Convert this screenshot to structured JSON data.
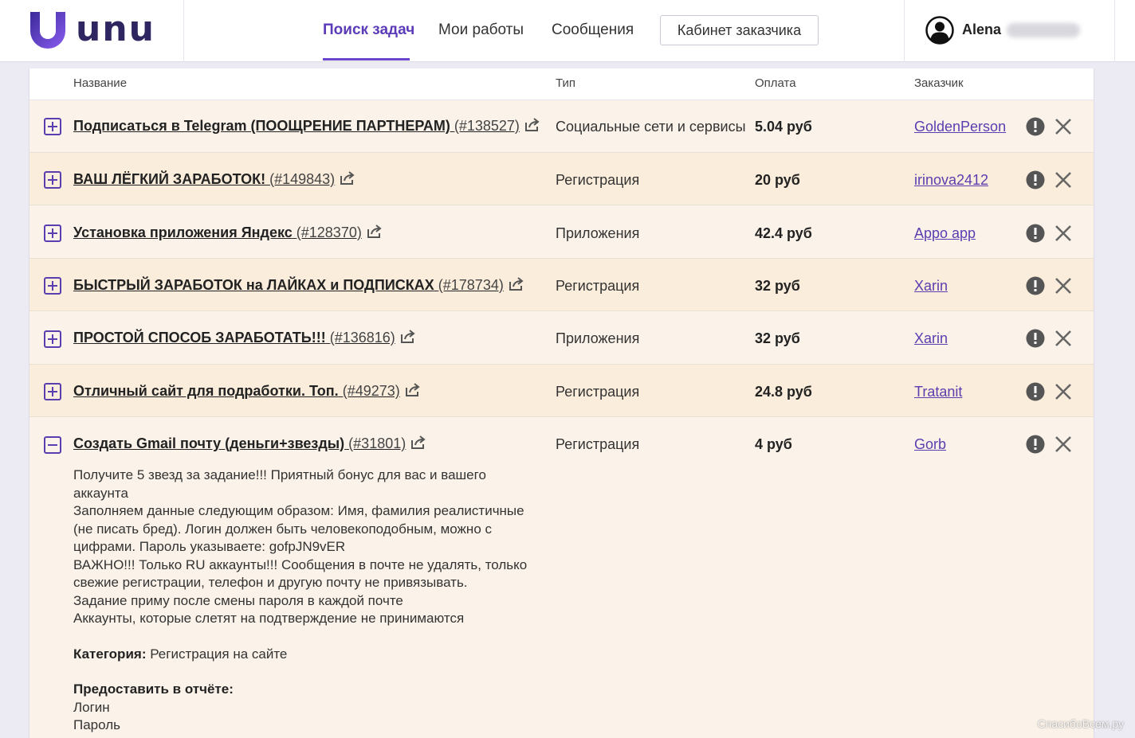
{
  "brand": {
    "name": "unu"
  },
  "nav": {
    "items": [
      {
        "label": "Поиск задач"
      },
      {
        "label": "Мои работы"
      },
      {
        "label": "Сообщения"
      }
    ],
    "cabinet_button": "Кабинет заказчика"
  },
  "user": {
    "name": "Alena"
  },
  "table": {
    "headers": [
      "Название",
      "Тип",
      "Оплата",
      "Заказчик"
    ],
    "rows": [
      {
        "title": "Подписаться в Telegram (ПООЩРЕНИЕ ПАРТНЕРАМ)",
        "id": "(#138527)",
        "type": "Социальные сети и сервисы",
        "pay": "5.04 руб",
        "client": "GoldenPerson"
      },
      {
        "title": "ВАШ ЛЁГКИЙ ЗАРАБОТОК!",
        "id": "(#149843)",
        "type": "Регистрация",
        "pay": "20 руб",
        "client": "irinova2412"
      },
      {
        "title": "Установка приложения Яндекс",
        "id": "(#128370)",
        "type": "Приложения",
        "pay": "42.4 руб",
        "client": "Appo app"
      },
      {
        "title": "БЫСТРЫЙ ЗАРАБОТОК на ЛАЙКАХ и ПОДПИСКАХ",
        "id": "(#178734)",
        "type": "Регистрация",
        "pay": "32 руб",
        "client": "Xarin"
      },
      {
        "title": "ПРОСТОЙ СПОСОБ ЗАРАБОТАТЬ!!!",
        "id": "(#136816)",
        "type": "Приложения",
        "pay": "32 руб",
        "client": "Xarin"
      },
      {
        "title": "Отличный сайт для подработки. Топ.",
        "id": "(#49273)",
        "type": "Регистрация",
        "pay": "24.8 руб",
        "client": "Tratanit"
      },
      {
        "title": "Создать Gmail почту (деньги+звезды)",
        "id": "(#31801)",
        "type": "Регистрация",
        "pay": "4 руб",
        "client": "Gorb"
      }
    ]
  },
  "expanded": {
    "lines": [
      "Получите 5 звезд за задание!!! Приятный бонус для вас и вашего",
      "аккаунта",
      "Заполняем данные следующим образом: Имя, фамилия реалистичные",
      "(не писать бред). Логин должен быть человекоподобным, можно с",
      "цифрами. Пароль указываете: gofpJN9vER",
      "ВАЖНО!!! Только RU аккаунты!!! Сообщения в почте не удалять, только",
      "свежие регистрации, телефон и другую почту не привязывать.",
      "Задание приму после смены пароля в каждой почте",
      "Аккаунты, которые слетят на подтверждение не принимаются"
    ],
    "category_label": "Категория:",
    "category_value": "Регистрация на сайте",
    "report_label": "Предоставить в отчёте:",
    "report_items": [
      "Логин",
      "Пароль"
    ]
  },
  "watermark": "СпасибоВсем.ру",
  "colors": {
    "accent": "#5a3eb0",
    "row_odd": "#fbf3e9",
    "row_even": "#fbeddb"
  }
}
